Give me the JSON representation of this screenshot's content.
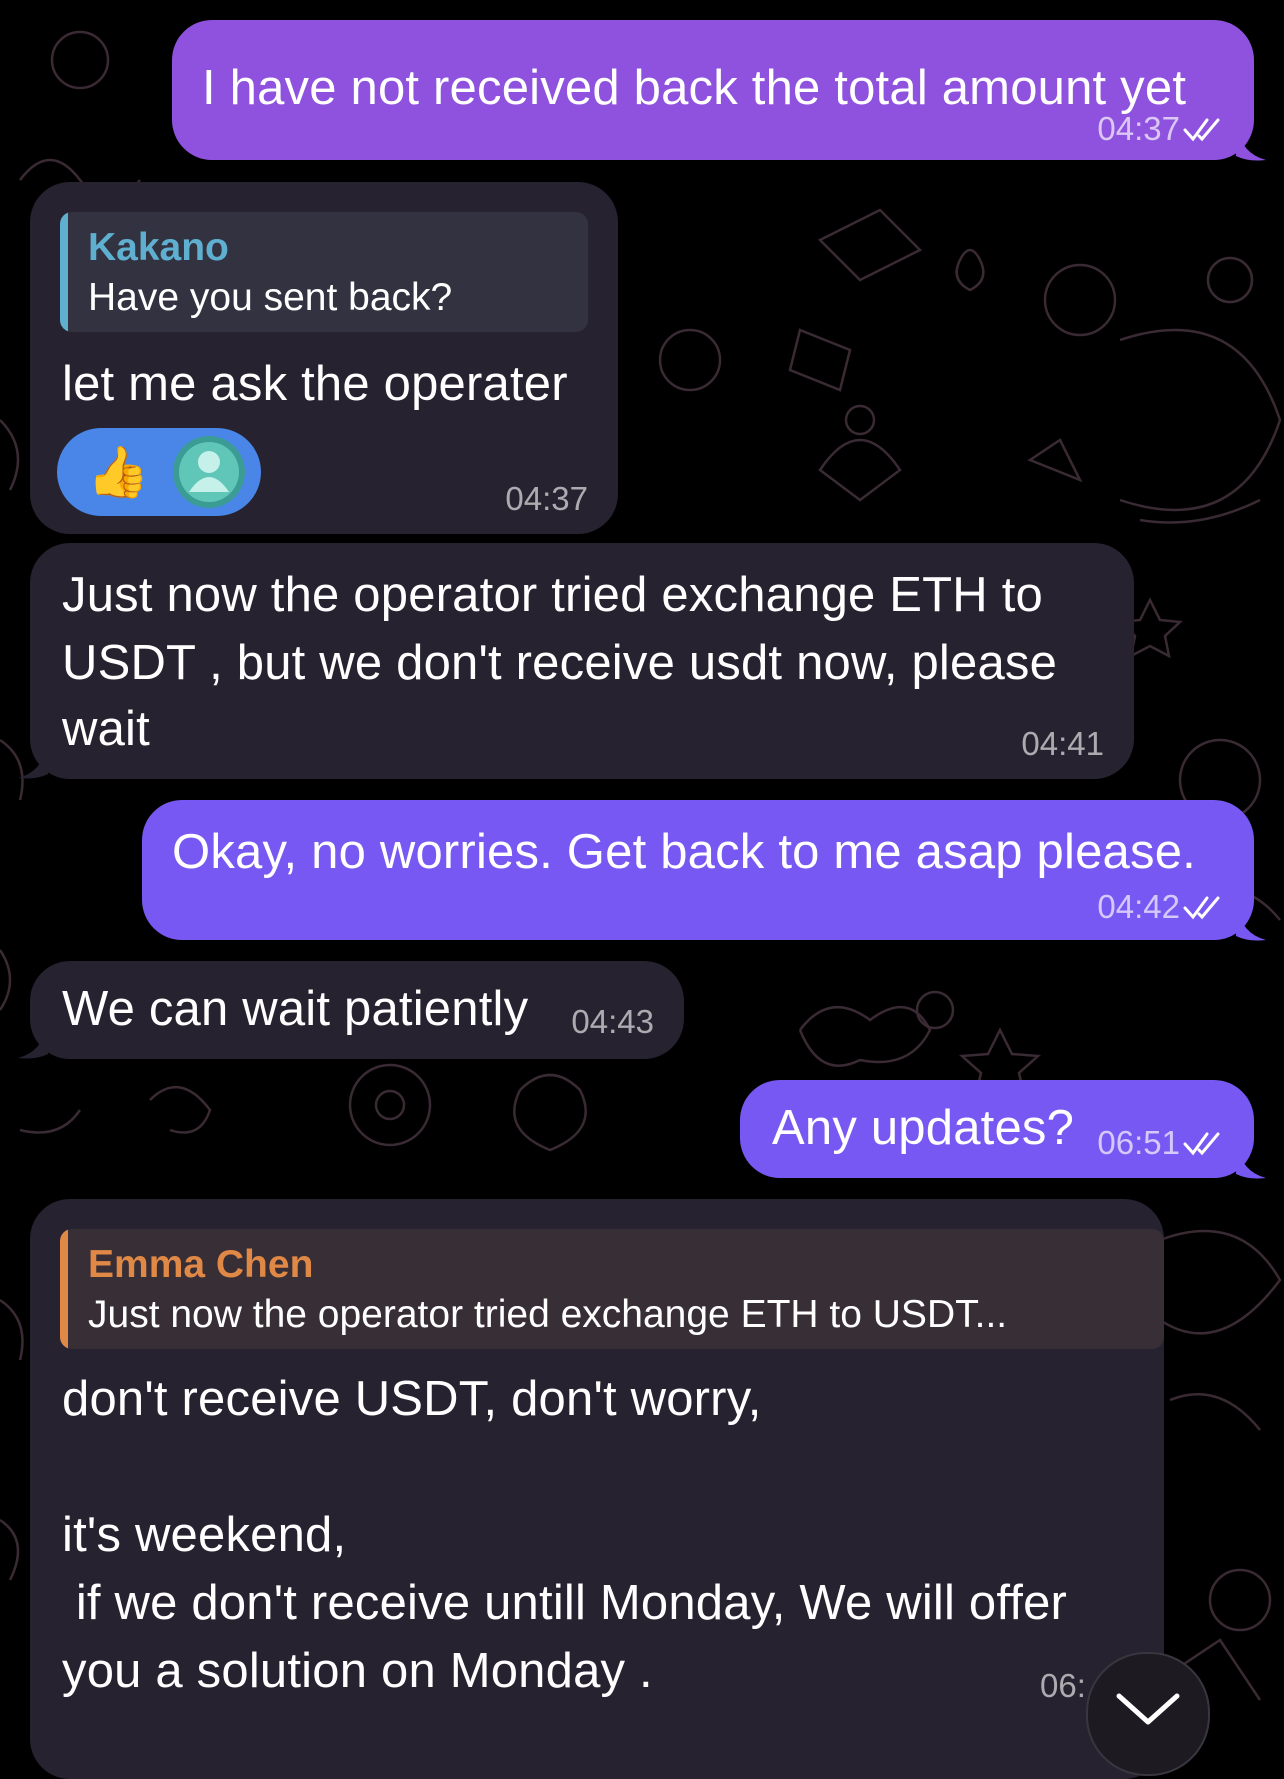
{
  "colors": {
    "outgoing_top": "#8f52de",
    "outgoing": "#7858f2",
    "incoming": "#262230",
    "reply_blue": "#5fb0d0",
    "reply_orange": "#e08845",
    "background": "#000000"
  },
  "messages": [
    {
      "side": "out",
      "text": "I have not received back the total amount yet",
      "time": "04:37",
      "status_icon": "double-check-icon"
    },
    {
      "side": "in",
      "reply_author": "Kakano",
      "reply_text": "Have you sent back?",
      "text": "let me ask the operater",
      "reactions": [
        "thumbs-up-icon",
        "user-avatar-icon"
      ],
      "time": "04:37"
    },
    {
      "side": "in",
      "text": "Just now the operator tried exchange ETH to USDT , but we don't receive usdt now, please wait",
      "line1": "Just now the operator tried exchange ETH to",
      "line2": "USDT , but we don't receive usdt now, please",
      "line3": "wait",
      "time": "04:41"
    },
    {
      "side": "out",
      "text": "Okay, no worries. Get back to me asap please.",
      "time": "04:42",
      "status_icon": "double-check-icon"
    },
    {
      "side": "in",
      "text": "We can wait patiently",
      "time": "04:43"
    },
    {
      "side": "out",
      "text": "Any updates?",
      "time": "06:51",
      "status_icon": "double-check-icon"
    },
    {
      "side": "in",
      "reply_author": "Emma Chen",
      "reply_text": "Just now the operator tried exchange ETH to USDT...",
      "line1": "don't receive USDT, don't worry,",
      "line2": "",
      "line3": "it's weekend,",
      "line4": " if we don't receive untill Monday, We will offer",
      "line5": "you a solution on Monday .",
      "time": "06:"
    }
  ],
  "scroll_down_icon": "chevron-down-icon"
}
